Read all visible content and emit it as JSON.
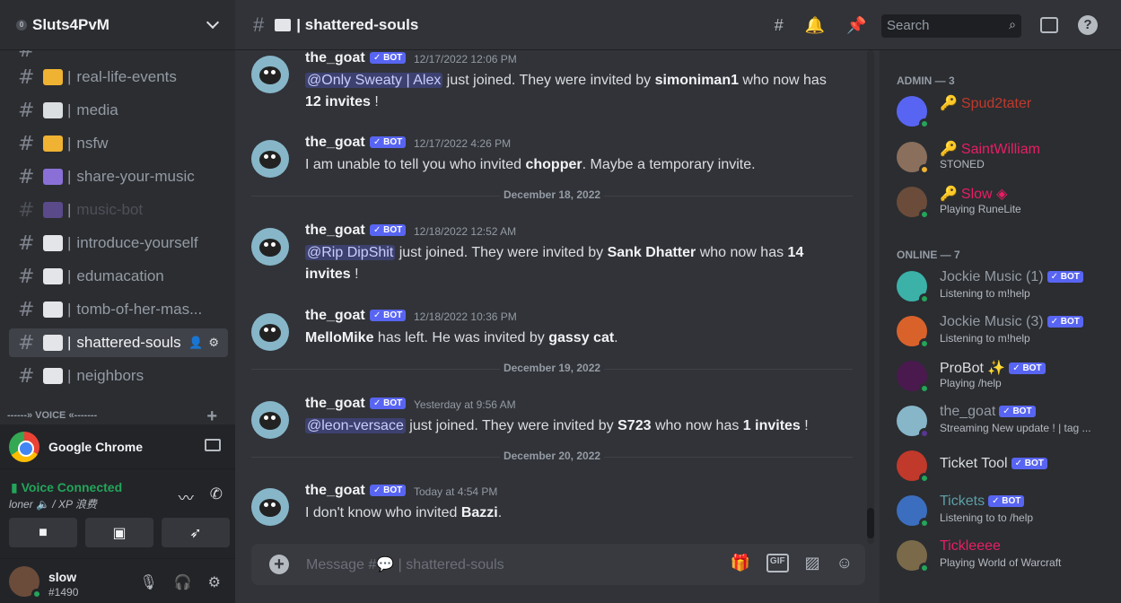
{
  "server": {
    "name": "Sluts4PvM",
    "boost": "0"
  },
  "channels": [
    {
      "label": "real-life-events",
      "emoji_color": "#f0b232"
    },
    {
      "label": "media",
      "emoji_color": "#404249"
    },
    {
      "label": "nsfw",
      "emoji_color": "#f0b232"
    },
    {
      "label": "share-your-music",
      "emoji_color": "#8a70d6"
    },
    {
      "label": "music-bot",
      "emoji_color": "#8a70d6"
    },
    {
      "label": "introduce-yourself",
      "emoji_color": "#e3e5e8"
    },
    {
      "label": "edumacation",
      "emoji_color": "#e3e5e8"
    },
    {
      "label": "tomb-of-her-mas...",
      "emoji_color": "#e3e5e8"
    },
    {
      "label": "shattered-souls",
      "emoji_color": "#e3e5e8"
    },
    {
      "label": "neighbors",
      "emoji_color": "#e3e5e8"
    }
  ],
  "voice_category": "------» VOICE «-------",
  "activity": {
    "label": "Google Chrome"
  },
  "voice": {
    "status": "Voice Connected",
    "sub": "loner 🔈 / XP 浪费"
  },
  "user": {
    "name": "slow",
    "tag": "#1490"
  },
  "header": {
    "channel": "shattered-souls",
    "search_placeholder": "Search"
  },
  "composer": {
    "placeholder": "Message #💬 | shattered-souls"
  },
  "bot_label": "✓ BOT",
  "messages": [
    {
      "author": "the_goat",
      "time": "12/17/2022 12:06 PM",
      "pre": "",
      "mention": "@Only Sweaty | Alex",
      "mid": " just joined. They were invited by ",
      "bold": "simoniman1",
      "post": " who now has ",
      "bold2": "12 invites",
      "end": " !"
    },
    {
      "author": "the_goat",
      "time": "12/17/2022 4:26 PM",
      "pre": "I am unable to tell you who invited ",
      "mention": "",
      "mid": "",
      "bold": "chopper",
      "post": ". Maybe a temporary invite.",
      "bold2": "",
      "end": ""
    },
    {
      "author": "the_goat",
      "time": "12/18/2022 12:52 AM",
      "pre": "",
      "mention": "@Rip DipShit",
      "mid": " just joined. They were invited by ",
      "bold": "Sank Dhatter",
      "post": " who now has ",
      "bold2": "14 invites",
      "end": " !"
    },
    {
      "author": "the_goat",
      "time": "12/18/2022 10:36 PM",
      "pre": "",
      "mention": "",
      "mid": "",
      "bold": "MelloMike",
      "post": " has left. He was invited by ",
      "bold2": "gassy cat",
      "end": "."
    },
    {
      "author": "the_goat",
      "time": "Yesterday at 9:56 AM",
      "pre": "",
      "mention": "@leon-versace",
      "mid": " just joined. They were invited by ",
      "bold": "S723",
      "post": " who now has ",
      "bold2": "1 invites",
      "end": " !"
    },
    {
      "author": "the_goat",
      "time": "Today at 4:54 PM",
      "pre": "I don't know who invited ",
      "mention": "",
      "mid": "",
      "bold": "Bazzi",
      "post": ".",
      "bold2": "",
      "end": ""
    }
  ],
  "dividers": [
    "December 18, 2022",
    "December 19, 2022",
    "December 20, 2022"
  ],
  "members": {
    "admin_label": "ADMIN — 3",
    "online_label": "ONLINE — 7",
    "admins": [
      {
        "name": "Spud2tater",
        "sub": "",
        "color": "#c0392b"
      },
      {
        "name": "SaintWilliam",
        "sub": "STONED",
        "color": "#e91e63"
      },
      {
        "name": "Slow",
        "sub": "Playing RuneLite",
        "color": "#e91e63"
      }
    ],
    "online": [
      {
        "name": "Jockie Music (1)",
        "sub": "Listening to m!help",
        "color": "#949ba4"
      },
      {
        "name": "Jockie Music (3)",
        "sub": "Listening to m!help",
        "color": "#949ba4"
      },
      {
        "name": "ProBot",
        "sub": "Playing /help",
        "color": "#dbdee1"
      },
      {
        "name": "the_goat",
        "sub": "Streaming New update ! | tag ...",
        "color": "#949ba4"
      },
      {
        "name": "Ticket Tool",
        "sub": "",
        "color": "#dbdee1"
      },
      {
        "name": "Tickets",
        "sub": "Listening to to /help",
        "color": "#5d9fa6"
      },
      {
        "name": "Tickleeee",
        "sub": "Playing World of Warcraft",
        "color": "#e91e63"
      }
    ]
  },
  "colors": {
    "accent": "#5865f2",
    "online": "#23a55a",
    "background": "#313338"
  }
}
